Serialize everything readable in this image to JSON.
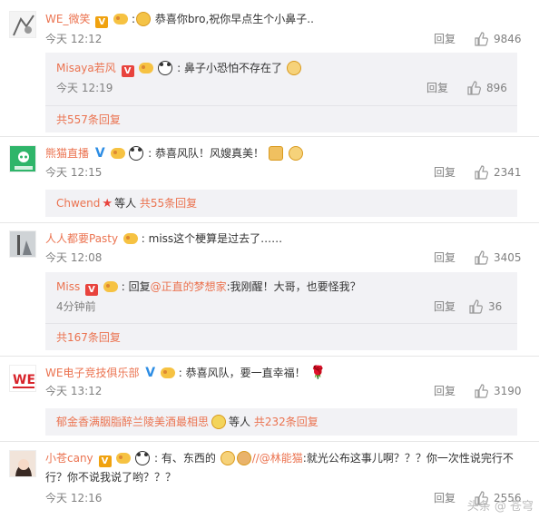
{
  "c1": {
    "user": "WE_微笑",
    "text": "恭喜你bro,祝你早点生个小鼻子..",
    "time": "今天 12:12",
    "reply": "回复",
    "likes": "9846",
    "sub": {
      "user": "Misaya若风",
      "text": "鼻子小恐怕不存在了",
      "time": "今天 12:19",
      "reply": "回复",
      "likes": "896"
    },
    "more": "共557条回复"
  },
  "c2": {
    "user": "熊猫直播",
    "text": "恭喜风队！风嫂真美！",
    "time": "今天 12:15",
    "reply": "回复",
    "likes": "2341",
    "more_user": "Chwend",
    "more_mid": "等人",
    "more": "共55条回复"
  },
  "c3": {
    "user": "人人都要Pasty",
    "text": "miss这个梗算是过去了……",
    "time": "今天 12:08",
    "reply": "回复",
    "likes": "3405",
    "sub": {
      "user": "Miss",
      "text_pre": "回复",
      "mention": "@正直的梦想家",
      "text": ":我刚醒！大哥，也要怪我？",
      "time": "4分钟前",
      "reply": "回复",
      "likes": "36"
    },
    "more": "共167条回复"
  },
  "c4": {
    "user": "WE电子竞技俱乐部",
    "text": "恭喜风队，要一直幸福！",
    "time": "今天 13:12",
    "reply": "回复",
    "likes": "3190",
    "more_user": "郁金香满胭脂醉兰陵美酒最相思",
    "more_mid": "等人",
    "more": "共232条回复"
  },
  "c5": {
    "user": "小苍cany",
    "text1": "有、东西的",
    "mention": "//@林能猫",
    "text2": ":就光公布这事儿啊？？？你一次性说完行不",
    "text3": "行？你不说我说了哟？？？",
    "time": "今天 12:16",
    "reply": "回复",
    "likes": "2556"
  },
  "watermark": "头条 @ 苍穹"
}
